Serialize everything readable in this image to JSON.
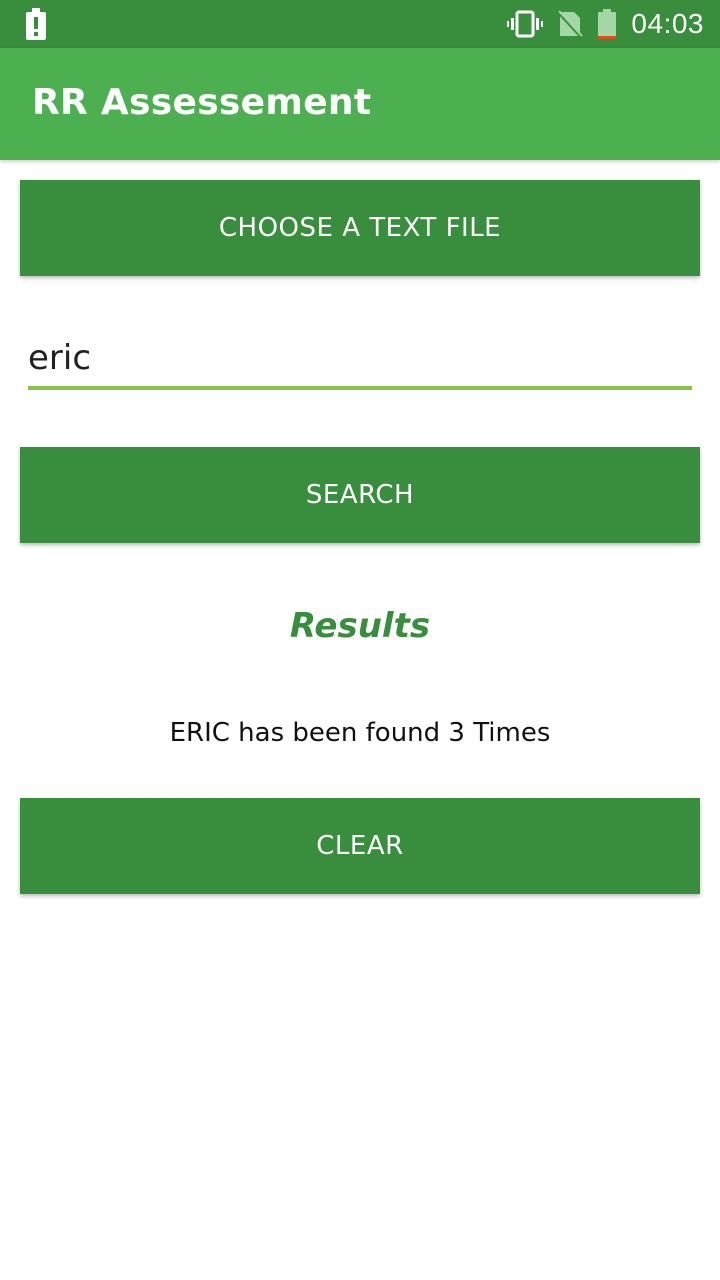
{
  "status_bar": {
    "time": "04:03",
    "icons": [
      "battery-alert-icon",
      "vibrate-icon",
      "no-sim-icon",
      "battery-icon"
    ]
  },
  "app_bar": {
    "title": "RR Assessement"
  },
  "main": {
    "choose_button_label": "CHOOSE A TEXT FILE",
    "search_input_value": "eric",
    "search_button_label": "SEARCH",
    "results_heading": "Results",
    "results_text": "ERIC has been found 3 Times",
    "clear_button_label": "CLEAR"
  },
  "colors": {
    "status_bar": "#388e3c",
    "app_bar": "#4caf50",
    "button": "#388e3c",
    "input_underline": "#8bc34a",
    "results_heading": "#388e3c"
  }
}
